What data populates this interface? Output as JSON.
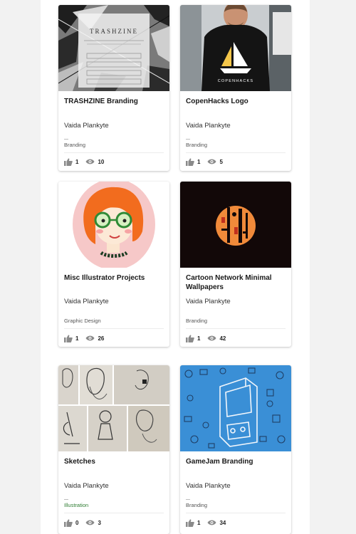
{
  "projects": [
    {
      "title": "TRASHZINE Branding",
      "author": "Vaida Plankyte",
      "category": "Branding",
      "likes": "1",
      "views": "10",
      "thumb_title": "TRASHZINE"
    },
    {
      "title": "CopenHacks Logo",
      "author": "Vaida Plankyte",
      "category": "Branding",
      "likes": "1",
      "views": "5",
      "thumb_title": "COPENHACKS"
    },
    {
      "title": "Misc Illustrator Projects",
      "author": "Vaida Plankyte",
      "category": "Graphic Design",
      "likes": "1",
      "views": "26"
    },
    {
      "title": "Cartoon Network Minimal Wallpapers",
      "author": "Vaida Plankyte",
      "category": "Branding",
      "likes": "1",
      "views": "42"
    },
    {
      "title": "Sketches",
      "author": "Vaida Plankyte",
      "category": "Illustration",
      "likes": "0",
      "views": "3"
    },
    {
      "title": "GameJam Branding",
      "author": "Vaida Plankyte",
      "category": "Branding",
      "likes": "1",
      "views": "34"
    }
  ],
  "icons": {
    "like": "thumbs-up-icon",
    "views": "eye-icon"
  },
  "colors": {
    "page_bg": "#f2f2f2",
    "card_bg": "#ffffff",
    "icon_gray": "#8a8a8a",
    "category_green": "#2e7d32"
  }
}
